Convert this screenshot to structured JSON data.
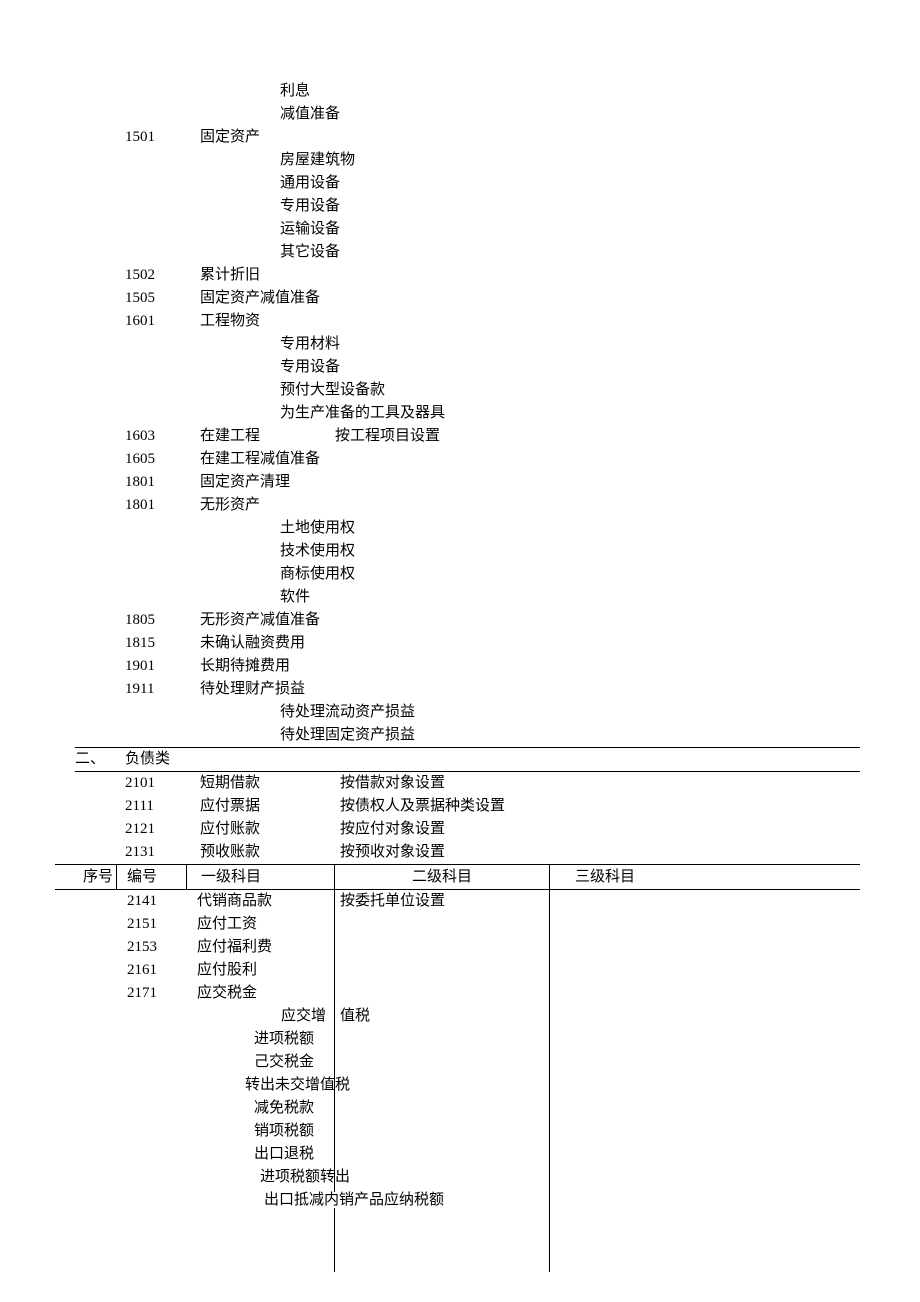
{
  "pre_sub": [
    "利息",
    "减值准备"
  ],
  "r1501": {
    "code": "1501",
    "l1": "固定资产",
    "subs": [
      "房屋建筑物",
      "通用设备",
      "专用设备",
      "运输设备",
      "其它设备"
    ]
  },
  "r1502": {
    "code": "1502",
    "l1": "累计折旧"
  },
  "r1505": {
    "code": "1505",
    "l1": "固定资产减值准备"
  },
  "r1601": {
    "code": "1601",
    "l1": "工程物资",
    "subs": [
      "专用材料",
      "专用设备",
      "预付大型设备款",
      "为生产准备的工具及器具"
    ]
  },
  "r1603": {
    "code": "1603",
    "l1": "在建工程",
    "l2": "按工程项目设置"
  },
  "r1605": {
    "code": "1605",
    "l1": "在建工程减值准备"
  },
  "r1801a": {
    "code": "1801",
    "l1": "固定资产清理"
  },
  "r1801b": {
    "code": "1801",
    "l1": "无形资产",
    "subs": [
      "土地使用权",
      "技术使用权",
      "商标使用权",
      "软件"
    ]
  },
  "r1805": {
    "code": "1805",
    "l1": "无形资产减值准备"
  },
  "r1815": {
    "code": "1815",
    "l1": "未确认融资费用"
  },
  "r1901": {
    "code": "1901",
    "l1": "长期待摊费用"
  },
  "r1911": {
    "code": "1911",
    "l1": "待处理财产损益",
    "subs": [
      "待处理流动资产损益",
      "待处理固定资产损益"
    ]
  },
  "section2": {
    "seq": "二、",
    "title": "负债类"
  },
  "r2101": {
    "code": "2101",
    "l1": "短期借款",
    "l2": "按借款对象设置"
  },
  "r2111": {
    "code": "2111",
    "l1": "应付票据",
    "l2": "按债权人及票据种类设置"
  },
  "r2121": {
    "code": "2121",
    "l1": "应付账款",
    "l2": "按应付对象设置"
  },
  "r2131": {
    "code": "2131",
    "l1": "预收账款",
    "l2": "按预收对象设置"
  },
  "header": {
    "seq": "序号",
    "code": "编号",
    "l1": "一级科目",
    "l2": "二级科目",
    "l3": "三级科目"
  },
  "r2141": {
    "code": "2141",
    "l1": "代销商品款",
    "l2": "按委托单位设置"
  },
  "r2151": {
    "code": "2151",
    "l1": "应付工资"
  },
  "r2153": {
    "code": "2153",
    "l1": "应付福利费"
  },
  "r2161": {
    "code": "2161",
    "l1": "应付股利"
  },
  "r2171": {
    "code": "2171",
    "l1": "应交税金"
  },
  "vat_title_a": "应交增",
  "vat_title_b": "值税",
  "vat_subs": [
    "进项税额",
    "己交税金",
    "转出未交增值税",
    "减免税款",
    "销项税额",
    "出口退税",
    "进项税额转出",
    "出口抵减内销产品应纳税额"
  ]
}
